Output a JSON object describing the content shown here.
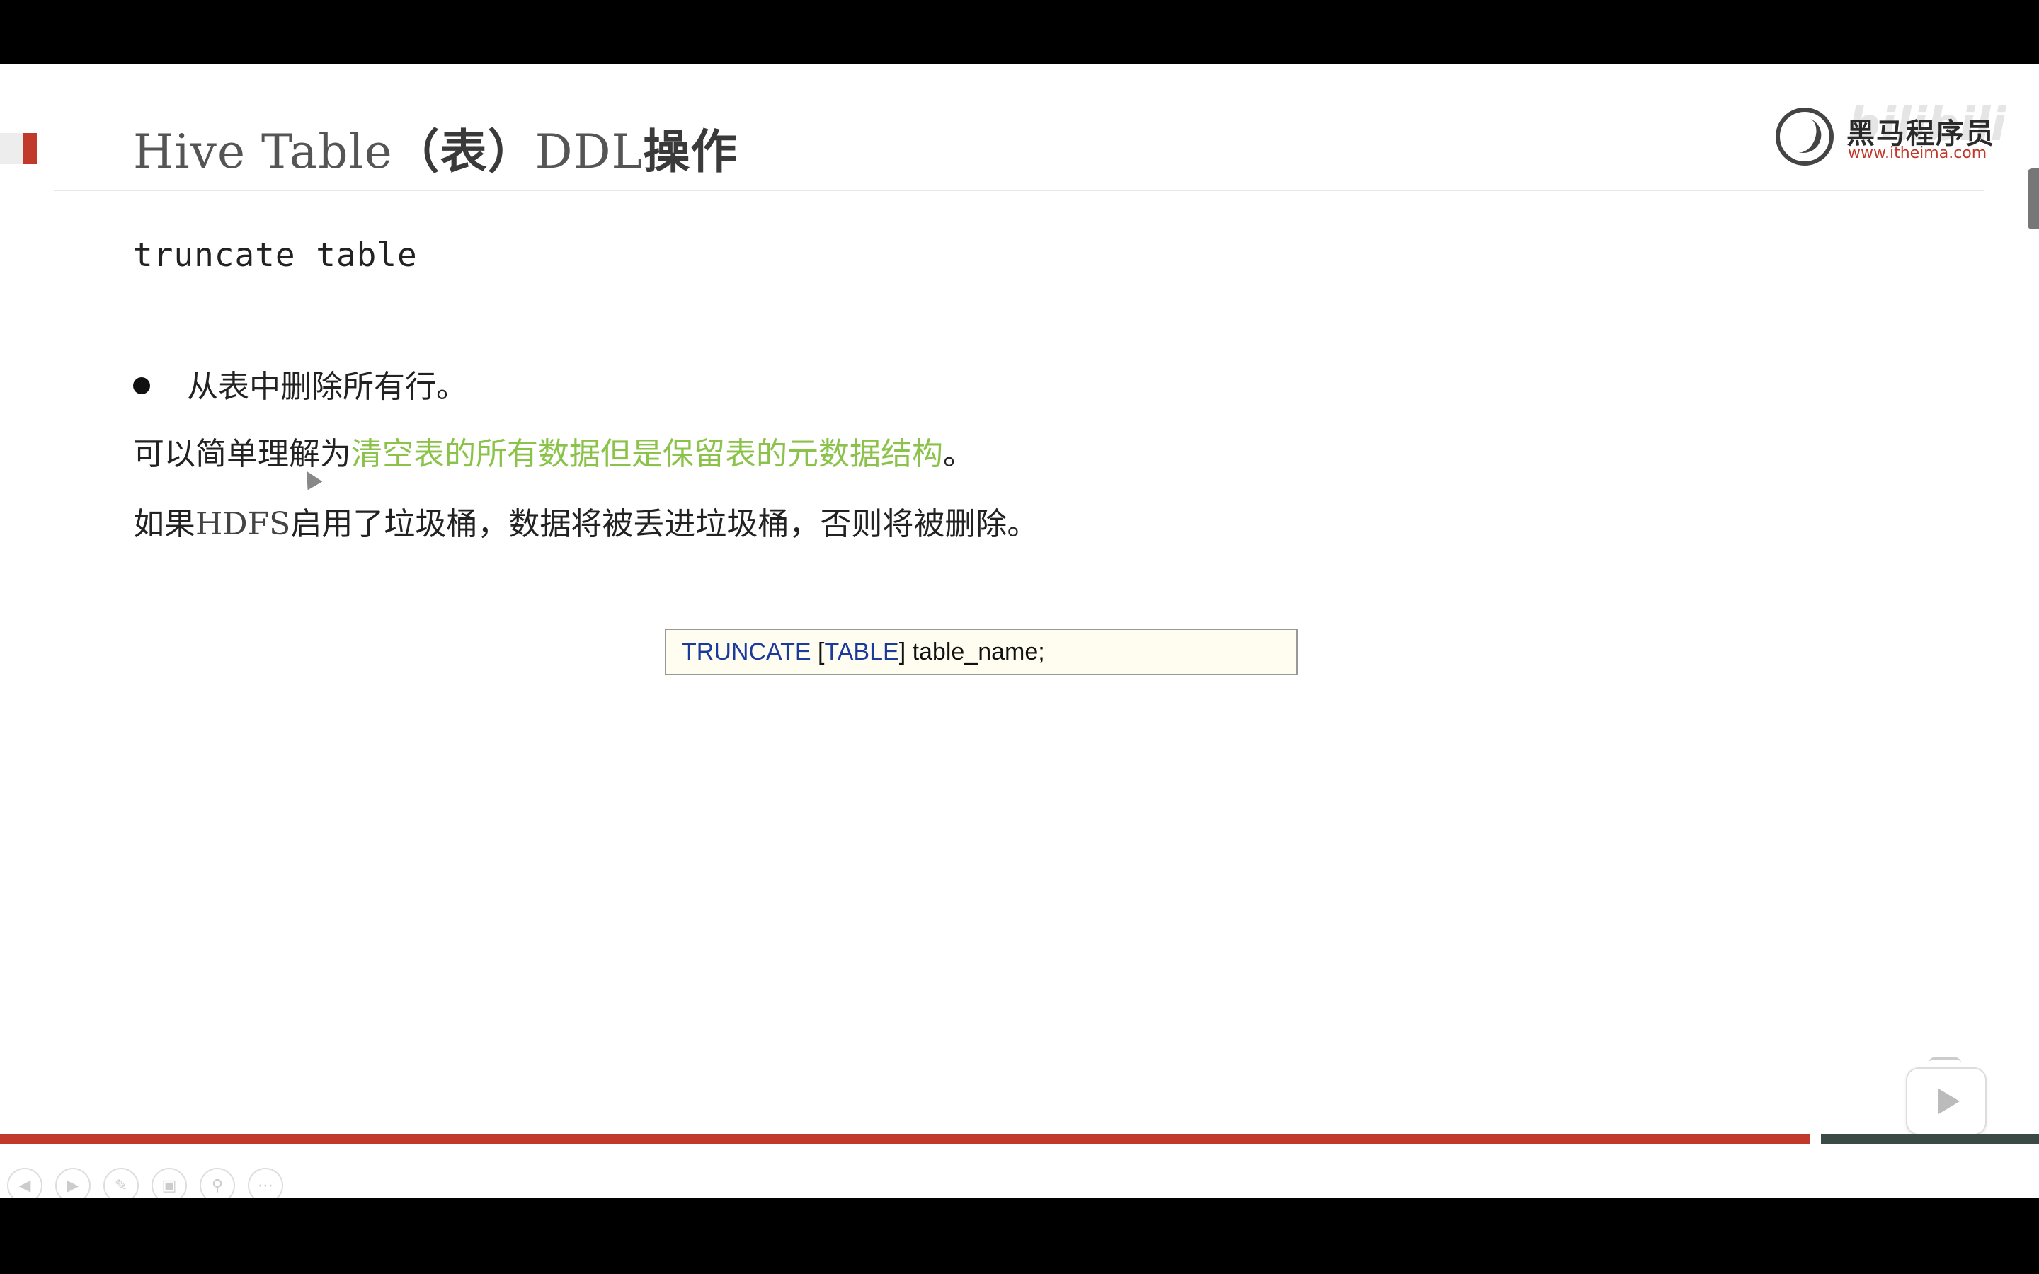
{
  "slide": {
    "title_latin": "Hive Table",
    "title_paren": "（表）",
    "title_ddl": "DDL",
    "title_op": "操作",
    "logo_name": "黑马程序员",
    "logo_url": "www.itheima.com",
    "watermark": "bilibili",
    "subtitle": "truncate table",
    "bullet": "从表中删除所有行。",
    "line1_prefix": "可以简单理解为",
    "line1_highlight": "清空表的所有数据但是保留表的元数据结构",
    "line1_suffix": "。",
    "line2_prefix": "如果",
    "line2_hdfs": "HDFS",
    "line2_rest": "启用了垃圾桶，数据将被丢进垃圾桶，否则将被删除。",
    "code_kw1": "TRUNCATE",
    "code_bracket_open": " [",
    "code_kw2": "TABLE",
    "code_rest": "] table_name;"
  },
  "colors": {
    "accent_red": "#c0392b",
    "highlight_green": "#8bc34a",
    "keyword_blue": "#1a3a9e",
    "code_bg": "#fffdf0"
  },
  "controls": [
    "prev-icon",
    "next-icon",
    "pen-icon",
    "slides-icon",
    "zoom-icon",
    "more-icon"
  ],
  "progress": {
    "played_fraction": 0.887
  }
}
